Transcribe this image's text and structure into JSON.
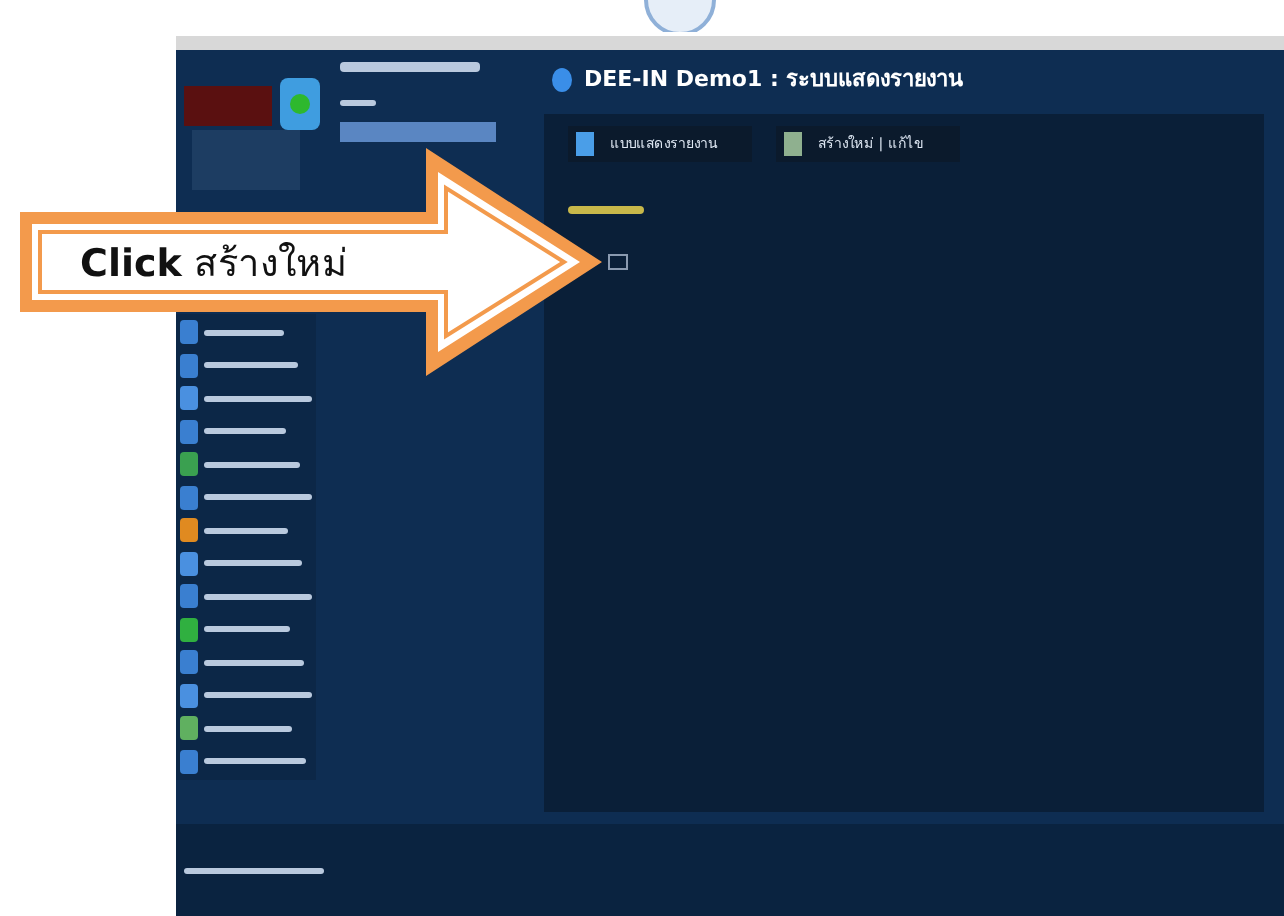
{
  "header": {
    "title": "DEE-IN Demo1 : ระบบแสดงรายงาน"
  },
  "tabs": [
    {
      "label": "แบบแสดงรายงาน",
      "selected": false
    },
    {
      "label": "สร้างใหม่ | แก้ไข",
      "selected": false
    }
  ],
  "sidebar": {
    "items": [
      {
        "color": "#3a7fd0"
      },
      {
        "color": "#3a7fd0"
      },
      {
        "color": "#4a90e0"
      },
      {
        "color": "#3a7fd0"
      },
      {
        "color": "#3aa050"
      },
      {
        "color": "#3a7fd0"
      },
      {
        "color": "#e08a20"
      },
      {
        "color": "#4a90e0"
      },
      {
        "color": "#3a7fd0"
      },
      {
        "color": "#30b040"
      },
      {
        "color": "#3a7fd0"
      },
      {
        "color": "#4a90e0"
      },
      {
        "color": "#60b060"
      },
      {
        "color": "#3a7fd0"
      }
    ]
  },
  "callout": {
    "text": "**Click** สร้างใหม่"
  }
}
